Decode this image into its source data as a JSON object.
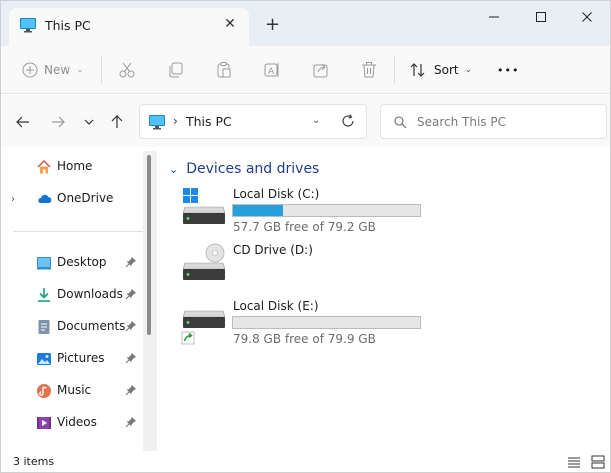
{
  "window": {
    "tab_title": "This PC",
    "tab_close_glyph": "✕",
    "new_tab_glyph": "+",
    "minimize_glyph": "—",
    "maximize_glyph": "☐",
    "close_glyph": "✕"
  },
  "toolbar": {
    "new_label": "New",
    "sort_label": "Sort",
    "more_label": "•••",
    "icons": [
      "plus-icon",
      "cut-icon",
      "copy-icon",
      "paste-icon",
      "rename-icon",
      "share-icon",
      "delete-icon",
      "sort-icon"
    ]
  },
  "address": {
    "separator": "›",
    "location": "This PC"
  },
  "search": {
    "placeholder": "Search This PC"
  },
  "sidebar": {
    "items": [
      {
        "label": "Home",
        "icon": "home-icon"
      },
      {
        "label": "OneDrive",
        "icon": "onedrive-cloud-icon",
        "expandable": true
      },
      {
        "label": "Desktop",
        "icon": "desktop-folder-icon",
        "pinned": true
      },
      {
        "label": "Downloads",
        "icon": "downloads-icon",
        "pinned": true
      },
      {
        "label": "Documents",
        "icon": "documents-icon",
        "pinned": true
      },
      {
        "label": "Pictures",
        "icon": "pictures-icon",
        "pinned": true
      },
      {
        "label": "Music",
        "icon": "music-icon",
        "pinned": true
      },
      {
        "label": "Videos",
        "icon": "videos-icon",
        "pinned": true
      }
    ]
  },
  "main": {
    "group_title": "Devices and drives",
    "drives": [
      {
        "name": "Local Disk (C:)",
        "free_text": "57.7 GB free of 79.2 GB",
        "used_fraction": 0.27,
        "icon": "system-drive-icon"
      },
      {
        "name": "CD Drive (D:)",
        "free_text": "",
        "icon": "cd-drive-icon"
      },
      {
        "name": "Local Disk (E:)",
        "free_text": "79.8 GB free of 79.9 GB",
        "used_fraction": 0.0,
        "icon": "shared-drive-icon"
      }
    ]
  },
  "status": {
    "item_count": "3 items"
  },
  "colors": {
    "accent_blue": "#26a0da",
    "group_title": "#1f3f8a",
    "titlebar_bg": "#e9eef5"
  }
}
